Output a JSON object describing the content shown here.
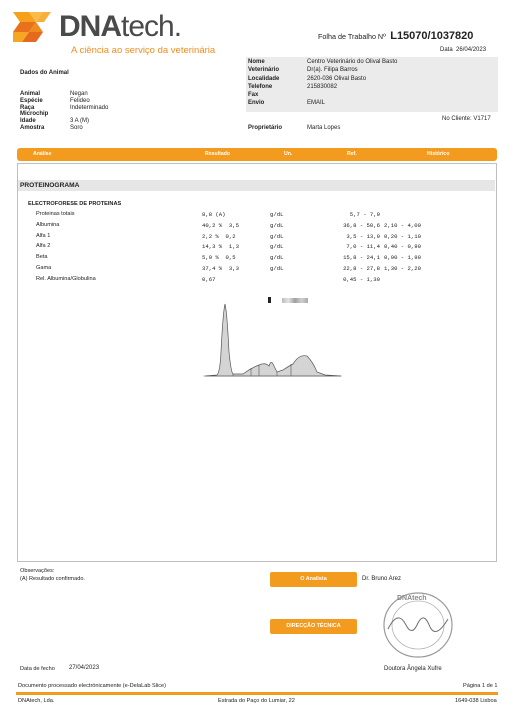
{
  "logo": {
    "brand_main": "DNA",
    "brand_suffix": "tech.",
    "tagline": "A ciência ao serviço da veterinária"
  },
  "header": {
    "worksheet_label": "Folha de Trabalho Nº",
    "worksheet_number": "L15070/1037820",
    "date_label": "Data",
    "date_value": "26/04/2023"
  },
  "animal": {
    "section_title": "Dados do Animal",
    "fields": [
      {
        "label": "Animal",
        "value": "Negan"
      },
      {
        "label": "Espécie",
        "value": "Felideo"
      },
      {
        "label": "Raça",
        "value": "Indeterminado"
      },
      {
        "label": "Microchip",
        "value": ""
      },
      {
        "label": "Idade",
        "value": "3 A (M)"
      },
      {
        "label": "Amostra",
        "value": "Soro"
      }
    ]
  },
  "clinic": {
    "fields": [
      {
        "label": "Nome",
        "value": "Centro Veterinário do Olival Basto"
      },
      {
        "label": "Veterinário",
        "value": "Dr(a). Filipa Barros"
      },
      {
        "label": "Localidade",
        "value": "2620-036 Olival Basto"
      },
      {
        "label": "Telefone",
        "value": "215830082"
      },
      {
        "label": "Fax",
        "value": ""
      },
      {
        "label": "Envio",
        "value": "EMAIL"
      }
    ],
    "client_no": "No Cliente: V1717",
    "owner_label": "Proprietário",
    "owner_value": "Marta Lopes"
  },
  "table_header": {
    "analise": "Análise",
    "resultado": "Resultado",
    "un": "Un.",
    "ref": "Ref.",
    "historico": "Histórico"
  },
  "section": {
    "title": "PROTEINOGRAMA",
    "subtitle": "ELECTROFORESE DE PROTEINAS"
  },
  "rows": [
    {
      "name": "Proteinas totais",
      "result": "8,8 (A)",
      "unit": "g/dL",
      "ref": "5,7 - 7,9",
      "ref2": ""
    },
    {
      "name": "Albumina",
      "result": "40,2 %  3,5",
      "unit": "g/dL",
      "ref": "36,8 - 50,6",
      "ref2": "2,10 - 4,00"
    },
    {
      "name": "Alfa 1",
      "result": "2,2 %  0,2",
      "unit": "g/dL",
      "ref": "3,5 - 13,9",
      "ref2": "0,20 - 1,10"
    },
    {
      "name": "Alfa 2",
      "result": "14,3 %  1,3",
      "unit": "g/dL",
      "ref": "7,0 - 11,4",
      "ref2": "0,40 - 0,90"
    },
    {
      "name": "Beta",
      "result": "5,9 %  0,5",
      "unit": "g/dL",
      "ref": "15,8 - 24,1",
      "ref2": "0,90 - 1,90"
    },
    {
      "name": "Gama",
      "result": "37,4 %  3,3",
      "unit": "g/dL",
      "ref": "22,8 - 27,8",
      "ref2": "1,30 - 2,20"
    },
    {
      "name": "Rel. Albumina/Globulina",
      "result": "0,67",
      "unit": "",
      "ref": "0,45 - 1,30",
      "ref2": ""
    }
  ],
  "observations": {
    "label": "Observações:",
    "text": "(A) Resultado confirmado."
  },
  "signatures": {
    "analyst_button": "O Analista",
    "analyst_name": "Dr. Bruno Arez",
    "direction_button": "DIRECÇÃO TÉCNICA",
    "director_name": "Doutora Ângela Xufre",
    "stamp_text": "DNAtech"
  },
  "closing": {
    "label": "Data de fecho",
    "value": "27/04/2023"
  },
  "footer": {
    "processed": "Documento processado electrónicamente (e-DelaLab Slice)",
    "page": "Página 1 de 1",
    "company": "DNAtech, Lda.",
    "address": "Estrada do Paço do Lumiar, 22",
    "postal": "1649-038 Lisboa"
  },
  "colors": {
    "accent": "#f29b1f",
    "text": "#222222"
  }
}
